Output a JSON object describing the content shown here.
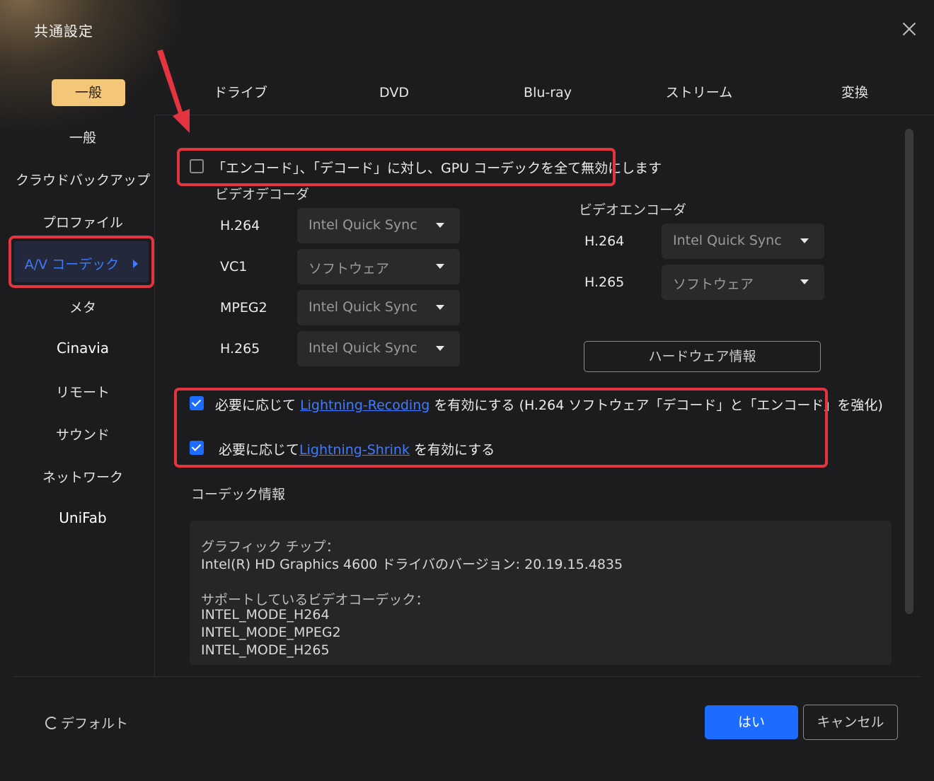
{
  "window": {
    "title": "共通設定",
    "close_icon": "close-icon"
  },
  "tabs": [
    {
      "label": "一般",
      "active": true
    },
    {
      "label": "ドライブ",
      "active": false
    },
    {
      "label": "DVD",
      "active": false
    },
    {
      "label": "Blu-ray",
      "active": false
    },
    {
      "label": "ストリーム",
      "active": false
    },
    {
      "label": "変換",
      "active": false
    }
  ],
  "sidebar": {
    "items": [
      {
        "label": "一般"
      },
      {
        "label": "クラウドバックアップ"
      },
      {
        "label": "プロファイル"
      },
      {
        "label": "A/V コーデック",
        "active": true
      },
      {
        "label": "メタ"
      },
      {
        "label": "Cinavia"
      },
      {
        "label": "リモート"
      },
      {
        "label": "サウンド"
      },
      {
        "label": "ネットワーク"
      },
      {
        "label": "UniFab"
      }
    ]
  },
  "main": {
    "disable_gpu": {
      "label": "「エンコード」、「デコード」に対し、GPU コーデックを全て無効にします",
      "checked": false
    },
    "decoder": {
      "heading": "ビデオデコーダ",
      "rows": [
        {
          "codec": "H.264",
          "value": "Intel Quick Sync"
        },
        {
          "codec": "VC1",
          "value": "ソフトウェア"
        },
        {
          "codec": "MPEG2",
          "value": "Intel Quick Sync"
        },
        {
          "codec": "H.265",
          "value": "Intel Quick Sync"
        }
      ]
    },
    "encoder": {
      "heading": "ビデオエンコーダ",
      "rows": [
        {
          "codec": "H.264",
          "value": "Intel Quick Sync"
        },
        {
          "codec": "H.265",
          "value": "ソフトウェア"
        }
      ]
    },
    "hardware_info_button": "ハードウェア情報",
    "recoding": {
      "checked": true,
      "prefix": "必要に応じて",
      "link": "Lightning-Recoding",
      "suffix": "を有効にする",
      "note": "(H.264 ソフトウェア「デコード」と「エンコード」を強化)"
    },
    "shrink": {
      "checked": true,
      "prefix": "必要に応じて",
      "link": "Lightning-Shrink",
      "suffix": "を有効にする"
    },
    "codec_info": {
      "heading": "コーデック情報",
      "lines": [
        "グラフィック チップ：",
        "Intel(R) HD Graphics 4600 ドライバのバージョン: 20.19.15.4835",
        "",
        "サポートしているビデオコーデック：",
        "INTEL_MODE_H264",
        "INTEL_MODE_MPEG2",
        "INTEL_MODE_H265"
      ]
    }
  },
  "footer": {
    "default_label": "デフォルト",
    "default_icon": "refresh-icon",
    "ok_label": "はい",
    "cancel_label": "キャンセル"
  },
  "colors": {
    "accent": "#1c6cff",
    "tab_active": "#f4c778",
    "highlight": "#e3343f",
    "link": "#3f7bff"
  }
}
